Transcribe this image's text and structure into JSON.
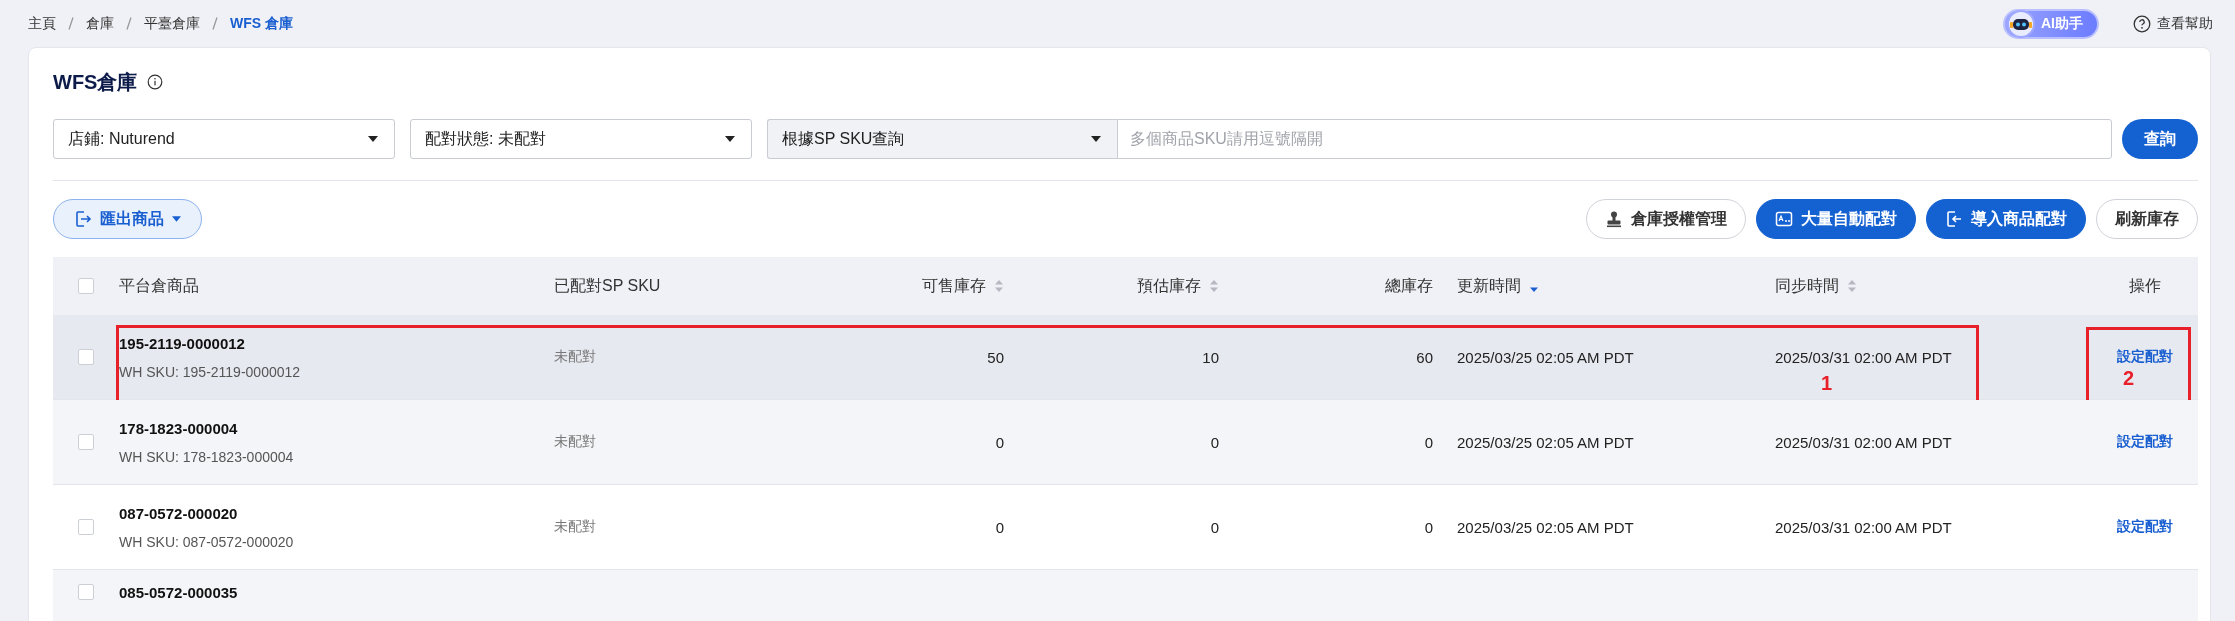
{
  "breadcrumb": [
    {
      "label": "主頁",
      "current": false
    },
    {
      "label": "倉庫",
      "current": false
    },
    {
      "label": "平臺倉庫",
      "current": false
    },
    {
      "label": "WFS 倉庫",
      "current": true
    }
  ],
  "header_actions": {
    "assistant": "AI助手",
    "help": "查看幫助"
  },
  "page_title": "WFS倉庫",
  "filters": {
    "store": "店鋪: Nuturend",
    "match_status": "配對狀態: 未配對",
    "search_type": "根據SP SKU查詢",
    "search": {
      "placeholder": "多個商品SKU請用逗號隔開"
    },
    "query_button": "查詢"
  },
  "toolbar": {
    "export": "匯出商品",
    "buttons": [
      {
        "label": "倉庫授權管理",
        "kind": "outline"
      },
      {
        "label": "大量自動配對",
        "kind": "primary"
      },
      {
        "label": "導入商品配對",
        "kind": "primary"
      },
      {
        "label": "刷新庫存",
        "kind": "outline"
      }
    ]
  },
  "table": {
    "select_all_checked": false,
    "columns": [
      {
        "label": "平台倉商品"
      },
      {
        "label": "已配對SP SKU"
      },
      {
        "label": "可售庫存",
        "sortable": true,
        "sorted": false
      },
      {
        "label": "預估庫存",
        "sortable": true,
        "sorted": false
      },
      {
        "label": "總庫存"
      },
      {
        "label": "更新時間",
        "sortable": true,
        "sorted": true
      },
      {
        "label": "同步時間",
        "sortable": true,
        "sorted": false
      },
      {
        "label": "操作"
      }
    ],
    "rows": [
      {
        "checked": false,
        "highlighted": true,
        "sku": "195-2119-0000012",
        "wh_sku": "WH SKU: 195-2119-0000012",
        "matched": "未配對",
        "available": "50",
        "forecast": "10",
        "total": "60",
        "updated": "2025/03/25 02:05 AM PDT",
        "synced": "2025/03/31 02:00 AM PDT",
        "action": "設定配對",
        "annotations": [
          {
            "label": "1"
          },
          {
            "label": "2"
          }
        ]
      },
      {
        "checked": false,
        "highlighted": false,
        "sku": "178-1823-000004",
        "wh_sku": "WH SKU: 178-1823-000004",
        "matched": "未配對",
        "available": "0",
        "forecast": "0",
        "total": "0",
        "updated": "2025/03/25 02:05 AM PDT",
        "synced": "2025/03/31 02:00 AM PDT",
        "action": "設定配對"
      },
      {
        "checked": false,
        "highlighted": false,
        "sku": "087-0572-000020",
        "wh_sku": "WH SKU: 087-0572-000020",
        "matched": "未配對",
        "available": "0",
        "forecast": "0",
        "total": "0",
        "updated": "2025/03/25 02:05 AM PDT",
        "synced": "2025/03/31 02:00 AM PDT",
        "action": "設定配對"
      },
      {
        "checked": false,
        "highlighted": false,
        "sku": "085-0572-000035"
      }
    ]
  }
}
